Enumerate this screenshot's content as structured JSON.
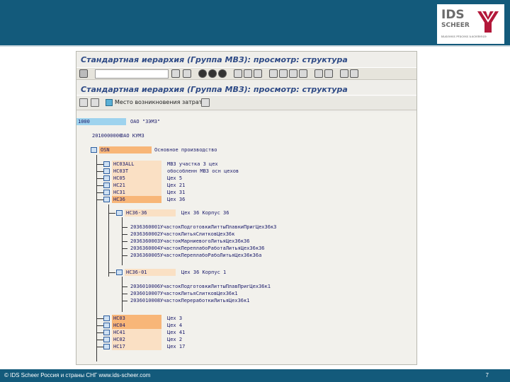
{
  "slide": {
    "logo": {
      "brand_top": "IDS",
      "brand_bottom": "SCHEER",
      "tagline": "Business Process Excellence"
    },
    "footer": {
      "copyright": "© IDS Scheer Россия и страны СНГ  www.ids-scheer.com",
      "page_number": "7"
    }
  },
  "sap": {
    "window_title": "Стандартная иерархия (Группа МВЗ): просмотр: структура",
    "screen_title": "Стандартная иерархия (Группа МВЗ): просмотр: структура",
    "command_field_value": "",
    "cost_center_button_label": "Место возникновения затрат",
    "tree": {
      "root": {
        "code": "1000",
        "desc": "ОАО \"ЗЭМЗ\""
      },
      "level1": {
        "code": "2010000000",
        "desc": "ОАО КУМЗ"
      },
      "group_main": {
        "code": "OSN",
        "desc": "Основное производство"
      },
      "groups_top": [
        {
          "code": "НС03ALL",
          "desc": "МВЗ участка 3 цех"
        },
        {
          "code": "НС03Т",
          "desc": "обособленн МВЗ осн цехов"
        },
        {
          "code": "НС05",
          "desc": "Цех 5"
        },
        {
          "code": "НС21",
          "desc": "Цех 21"
        },
        {
          "code": "НС31",
          "desc": "Цех 31"
        },
        {
          "code": "НС36",
          "desc": "Цех 36"
        }
      ],
      "sub1": {
        "code": "НС36-36",
        "desc": "Цех 36 Корпус 36"
      },
      "sub1_items": [
        {
          "code": "2036360001",
          "desc": "УчастокПодготовкиЛиттыПлавкиПригЦех36к3"
        },
        {
          "code": "2036360002",
          "desc": "УчастокЛитьяСлитковЦех36к"
        },
        {
          "code": "2036360003",
          "desc": "УчастокМарниевогоЛитьяЦех36к36"
        },
        {
          "code": "2036360004",
          "desc": "УчастокПереплабоРаботаЛитьяЦех36к36"
        },
        {
          "code": "2036360005",
          "desc": "УчастокПереплабоРабоЛитьяЦех36к36а"
        }
      ],
      "sub2": {
        "code": "НС36-01",
        "desc": "Цех 36 Корпус 1"
      },
      "sub2_items": [
        {
          "code": "2036010006",
          "desc": "УчастокПодготовкиЛиттыПлавПригЦех36к1"
        },
        {
          "code": "2036010007",
          "desc": "УчастокЛитьяСлитковЦех36к1"
        },
        {
          "code": "2036010008",
          "desc": "УчастокПереработкиЛитьяЦех36к1"
        }
      ],
      "groups_bottom": [
        {
          "code": "НС03",
          "desc": "Цех 3"
        },
        {
          "code": "НС04",
          "desc": "Цех 4"
        },
        {
          "code": "НС41",
          "desc": "Цех 41"
        },
        {
          "code": "НС02",
          "desc": "Цех 2"
        },
        {
          "code": "НС17",
          "desc": "Цех 17"
        }
      ]
    }
  },
  "colors": {
    "band": "#135a7b",
    "highlight_orange": "#f8b678",
    "highlight_peach": "#fae0c4",
    "highlight_blue": "#9ed3ee",
    "title_text": "#2e4a86"
  }
}
